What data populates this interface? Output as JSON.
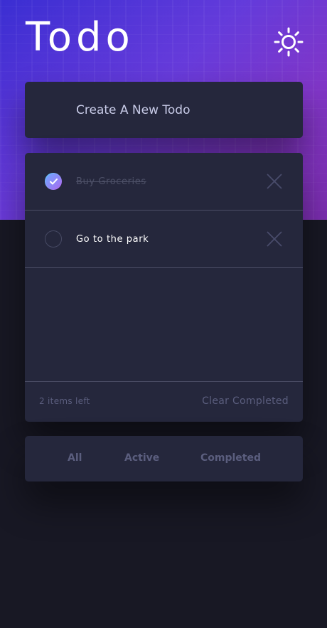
{
  "app": {
    "title": "Todo",
    "theme_icon": "sun-icon"
  },
  "new_todo": {
    "placeholder": "Create A New Todo"
  },
  "todos": [
    {
      "text": "Buy Groceries",
      "completed": true
    },
    {
      "text": "Go to the park",
      "completed": false
    }
  ],
  "footer": {
    "items_left": "2 items left",
    "clear_label": "Clear Completed"
  },
  "filters": {
    "all": "All",
    "active": "Active",
    "completed": "Completed"
  },
  "colors": {
    "background": "#181824",
    "card": "#25273c",
    "muted_text": "#5b5e7e",
    "accent_gradient_start": "#55ddff",
    "accent_gradient_end": "#c058f3"
  }
}
